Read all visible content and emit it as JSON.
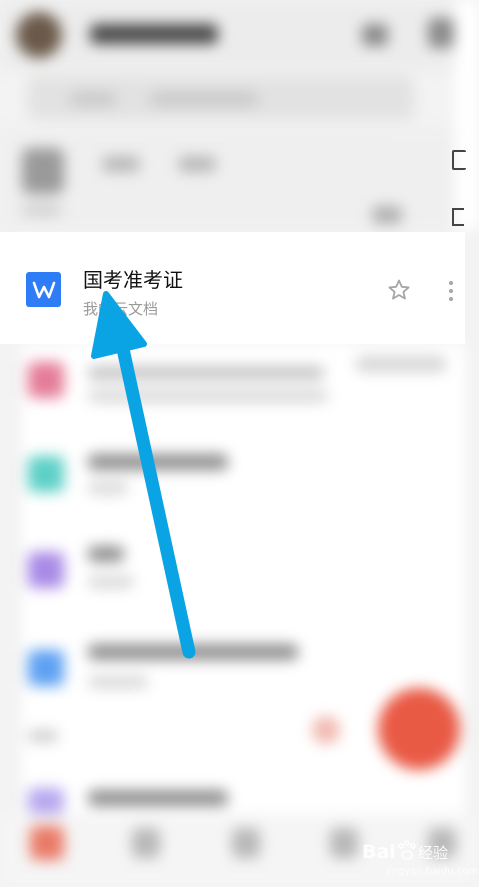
{
  "document": {
    "title": "国考准考证",
    "subtitle": "我的云文档",
    "icon": "wps-writer-doc-icon",
    "icon_letter": "W"
  },
  "watermark": {
    "domain": "jingyan.baidu.com"
  },
  "colors": {
    "doc_icon": "#2f7df6",
    "arrow": "#0aa3e3",
    "fab": "#e95a45"
  }
}
